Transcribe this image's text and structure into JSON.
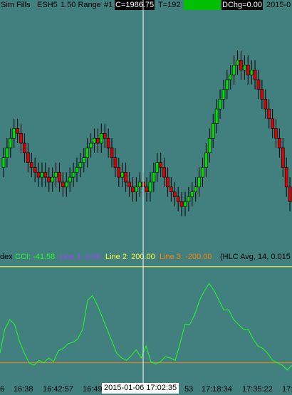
{
  "header": {
    "account": "Sim Fills",
    "instrument": "ESH5",
    "bar_type": "1.50 Range",
    "bar_number": "#1",
    "close": "C=1986.75",
    "ticks": "T=192",
    "green_field": "",
    "dchg": "DChg=0.00",
    "date": "2015-0"
  },
  "indicator": {
    "prefix": "dex",
    "cci": "CCI: -41.58",
    "line1": "Line 1: 0.00",
    "line2": "Line 2: 200.00",
    "line3": "Line 3: -200.00",
    "params": "(HLC Avg, 14, 0.015"
  },
  "x_axis": {
    "labels": [
      "6",
      "16:38",
      "16:42:57",
      "16:49",
      "53",
      "17:18:34",
      "17:35:22",
      "17:"
    ],
    "cursor_label": "2015-01-06  17:02:35"
  },
  "colors": {
    "background": "#41807f",
    "up_candle": "#00e000",
    "down_candle": "#e00000",
    "cci_line": "#20ff20",
    "line2": "#ffff40",
    "line3": "#ff8000",
    "line1": "#a040ff",
    "crosshair": "#ffffff"
  },
  "chart_data": [
    {
      "type": "candlestick",
      "title": "",
      "series": [
        {
          "name": "up",
          "values": []
        },
        {
          "name": "down",
          "values": []
        }
      ],
      "close_series": [
        1980.5,
        1981.0,
        1981.5,
        1982.0,
        1981.75,
        1981.25,
        1980.75,
        1980.25,
        1980.0,
        1979.75,
        1979.5,
        1979.75,
        1979.5,
        1979.25,
        1979.5,
        1979.75,
        1979.25,
        1979.0,
        1979.25,
        1979.5,
        1979.75,
        1980.0,
        1980.25,
        1980.5,
        1981.0,
        1981.25,
        1981.5,
        1981.25,
        1981.75,
        1981.5,
        1981.0,
        1980.5,
        1980.0,
        1979.5,
        1979.75,
        1979.25,
        1979.0,
        1978.75,
        1979.0,
        1979.25,
        1979.0,
        1978.75,
        1979.25,
        1979.75,
        1980.25,
        1980.0,
        1979.5,
        1979.0,
        1978.75,
        1978.5,
        1978.25,
        1978.0,
        1978.25,
        1978.5,
        1978.75,
        1979.0,
        1979.5,
        1980.0,
        1980.75,
        1981.5,
        1982.25,
        1983.0,
        1983.5,
        1984.0,
        1984.5,
        1984.75,
        1985.25,
        1985.5,
        1985.0,
        1985.25,
        1984.75,
        1985.0,
        1984.5,
        1984.0,
        1983.5,
        1983.0,
        1982.5,
        1982.0,
        1981.5,
        1981.0,
        1980.0,
        1979.0,
        1978.25
      ],
      "ylim": [
        1976,
        1988
      ]
    },
    {
      "type": "line",
      "title": "CCI",
      "series": [
        {
          "name": "CCI",
          "values": [
            -160,
            -60,
            -20,
            -40,
            -110,
            -160,
            -200,
            -210,
            -190,
            -200,
            -180,
            -195,
            -150,
            -140,
            -120,
            -115,
            -100,
            -60,
            60,
            80,
            40,
            -10,
            -60,
            -110,
            -160,
            -180,
            -190,
            -170,
            -145,
            -180,
            -130,
            -195,
            -205,
            -195,
            -175,
            -180,
            -190,
            -120,
            -40,
            -40,
            0,
            60,
            100,
            130,
            100,
            60,
            20,
            20,
            -20,
            -40,
            -60,
            -60,
            -100,
            -130,
            -140,
            -160,
            -190,
            -200,
            -210,
            -230,
            -210
          ]
        }
      ],
      "reference_lines": [
        {
          "name": "Line 2",
          "value": 200
        },
        {
          "name": "Line 1",
          "value": 0
        },
        {
          "name": "Line 3",
          "value": -200
        }
      ],
      "ylim": [
        -260,
        220
      ]
    }
  ]
}
